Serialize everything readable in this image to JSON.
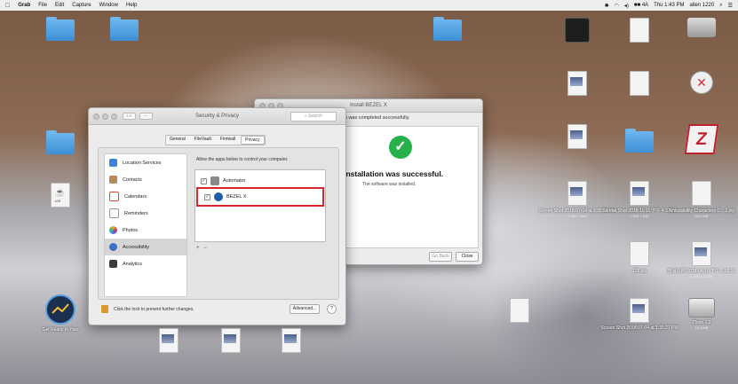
{
  "menubar": {
    "app": "Grab",
    "items": [
      "File",
      "Edit",
      "Capture",
      "Window",
      "Help"
    ],
    "status_battery": "■■ 4A",
    "clock": "Thu 1:43 PM",
    "user": "allen 1220"
  },
  "desktop_icons": [
    {
      "label": "",
      "sub": ""
    },
    {
      "label": "",
      "sub": ""
    },
    {
      "label": "",
      "sub": ""
    },
    {
      "label": "",
      "sub": ""
    },
    {
      "label": "JAR",
      "sub": ""
    },
    {
      "label": "",
      "sub": ""
    },
    {
      "label": "Screen Shot 2018-07-04 at 1:35:24 PM",
      "sub": "1,530 × 840"
    },
    {
      "label": "Screen Shot 2018-11-11 下午 4:37:24",
      "sub": "1,530 × 840"
    },
    {
      "label": "Screen Shot 2018-07-04 at 1:35:27 PM",
      "sub": ""
    },
    {
      "label": "125.xls",
      "sub": ""
    },
    {
      "label": "螢幕快照 2018-04-16 下午 1.56.15",
      "sub": "1,530 × 1,840"
    },
    {
      "label": "Zfone 1.2",
      "sub": "16.3 MB"
    },
    {
      "label": "Accessibility Characters C... 1.zip",
      "sub": "33.6 MB"
    }
  ],
  "security_window": {
    "title": "Security & Privacy",
    "search_placeholder": "Search",
    "tabs": [
      "General",
      "FileVault",
      "Firewall",
      "Privacy"
    ],
    "sidebar": [
      {
        "label": "Location Services",
        "color": "#3a86d6"
      },
      {
        "label": "Contacts",
        "color": "#b88a5a"
      },
      {
        "label": "Calendars",
        "color": "#e0463c"
      },
      {
        "label": "Reminders",
        "color": "#f2f2f2"
      },
      {
        "label": "Photos",
        "color": "#f0a030"
      },
      {
        "label": "Accessibility",
        "color": "#3a6fcf"
      },
      {
        "label": "Analytics",
        "color": "#3b3b3b"
      }
    ],
    "selected_index": 5,
    "description": "Allow the apps below to control your computer.",
    "apps": [
      {
        "name": "Automator",
        "checked": true
      },
      {
        "name": "BEZEL X",
        "checked": true
      }
    ],
    "lock_text": "Click the lock to prevent further changes.",
    "advanced_label": "Advanced...",
    "help_label": "?"
  },
  "installer_window": {
    "title": "Install BEZEL X",
    "header_text": "ation was completed successfully.",
    "success_title": "e installation was successful.",
    "success_sub": "The software was installed.",
    "go_back_label": "Go Back",
    "close_label": "Close"
  },
  "dock_item": {
    "label": "Get Ready to Plan"
  },
  "colors": {
    "success": "#28b14a",
    "highlight": "#d9262c",
    "selection": "#2b5fb8"
  }
}
